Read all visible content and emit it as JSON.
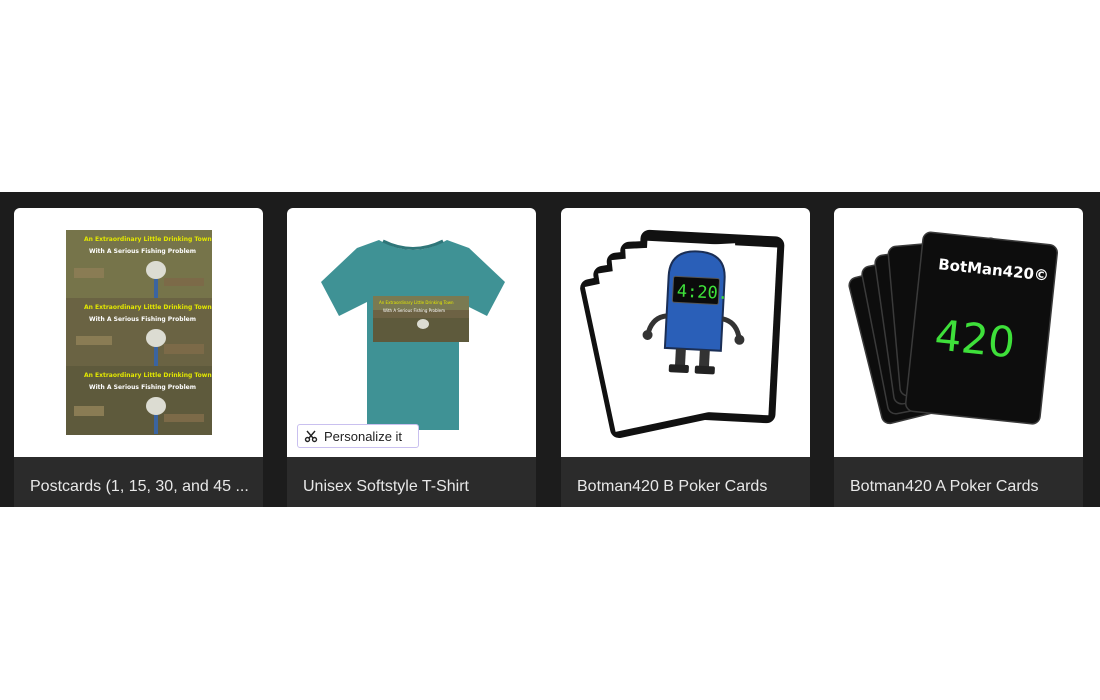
{
  "products": [
    {
      "title": "Postcards (1, 15, 30, and 45 ...",
      "image_icon": "postcard-image"
    },
    {
      "title": "Unisex Softstyle T-Shirt",
      "image_icon": "tshirt-image",
      "badge": "Personalize it"
    },
    {
      "title": "Botman420 B Poker Cards",
      "image_icon": "robot-cards-image"
    },
    {
      "title": "Botman420 A Poker Cards",
      "image_icon": "black-cards-image"
    }
  ],
  "postcard_art": {
    "line1": "An Extraordinary Little Drinking Town",
    "line2": "With A Serious Fishing Problem"
  },
  "robot_display": "4:20.",
  "card_art": {
    "brand": "BotMan420©",
    "number": "420"
  },
  "colors": {
    "strip": "#1c1c1c",
    "card": "#2b2b2b",
    "tshirt": "#3f9295",
    "robot": "#2a5fb8",
    "green": "#3ee03a"
  }
}
